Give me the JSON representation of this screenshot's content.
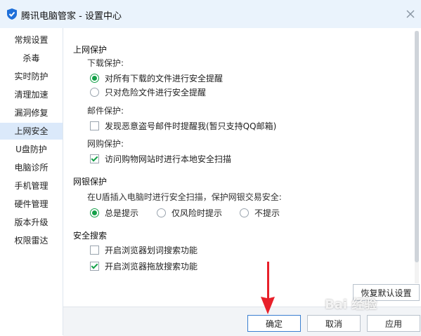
{
  "window": {
    "title": "腾讯电脑管家 - 设置中心"
  },
  "sidebar": {
    "items": [
      {
        "label": "常规设置"
      },
      {
        "label": "杀毒"
      },
      {
        "label": "实时防护"
      },
      {
        "label": "清理加速"
      },
      {
        "label": "漏洞修复"
      },
      {
        "label": "上网安全",
        "active": true
      },
      {
        "label": "U盘防护"
      },
      {
        "label": "电脑诊所"
      },
      {
        "label": "手机管理"
      },
      {
        "label": "硬件管理"
      },
      {
        "label": "版本升级"
      },
      {
        "label": "权限雷达"
      }
    ]
  },
  "web_protect": {
    "title": "上网保护",
    "download_label": "下载保护:",
    "download_opt1": "对所有下载的文件进行安全提醒",
    "download_opt2": "只对危险文件进行安全提醒",
    "mail_label": "邮件保护:",
    "mail_opt": "发现恶意盗号邮件时提醒我(暂只支持QQ邮箱)",
    "shop_label": "网购保护:",
    "shop_opt": "访问购物网站时进行本地安全扫描"
  },
  "bank_protect": {
    "title": "网银保护",
    "desc": "在U盾插入电脑时进行安全扫描，保护网银交易安全:",
    "opt1": "总是提示",
    "opt2": "仅风险时提示",
    "opt3": "不提示"
  },
  "safe_search": {
    "title": "安全搜索",
    "opt1": "开启浏览器划词搜索功能",
    "opt2": "开启浏览器拖放搜索功能"
  },
  "buttons": {
    "restore": "恢复默认设置",
    "ok": "确定",
    "cancel": "取消",
    "apply": "应用"
  },
  "watermark": "Bai 经验",
  "colors": {
    "accent": "#14a048",
    "titlebar": "#eaf3fc",
    "arrow": "#e8202a"
  }
}
